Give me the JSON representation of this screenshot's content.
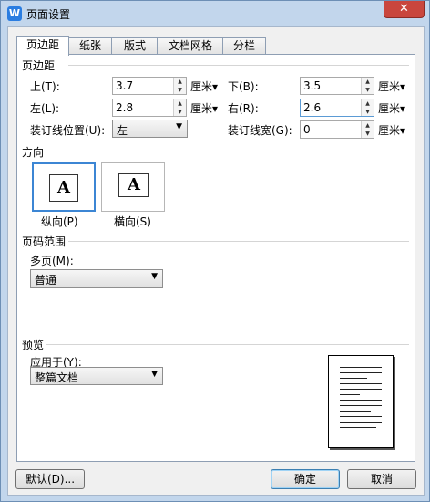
{
  "window": {
    "title": "页面设置",
    "close": "✕",
    "app_icon_letter": "W"
  },
  "tabs": [
    "页边距",
    "纸张",
    "版式",
    "文档网格",
    "分栏"
  ],
  "margins": {
    "group_title": "页边距",
    "top_label": "上(T):",
    "top_value": "3.7",
    "bottom_label": "下(B):",
    "bottom_value": "3.5",
    "left_label": "左(L):",
    "left_value": "2.8",
    "right_label": "右(R):",
    "right_value": "2.6",
    "gutter_pos_label": "装订线位置(U):",
    "gutter_pos_value": "左",
    "gutter_label": "装订线宽(G):",
    "gutter_value": "0",
    "unit": "厘米▾"
  },
  "orientation": {
    "group_title": "方向",
    "portrait_label": "纵向(P)",
    "landscape_label": "横向(S)",
    "glyph": "A"
  },
  "pages": {
    "group_title": "页码范围",
    "multi_label": "多页(M):",
    "multi_value": "普通"
  },
  "preview": {
    "group_title": "预览",
    "apply_label": "应用于(Y):",
    "apply_value": "整篇文档"
  },
  "buttons": {
    "default": "默认(D)...",
    "ok": "确定",
    "cancel": "取消"
  }
}
